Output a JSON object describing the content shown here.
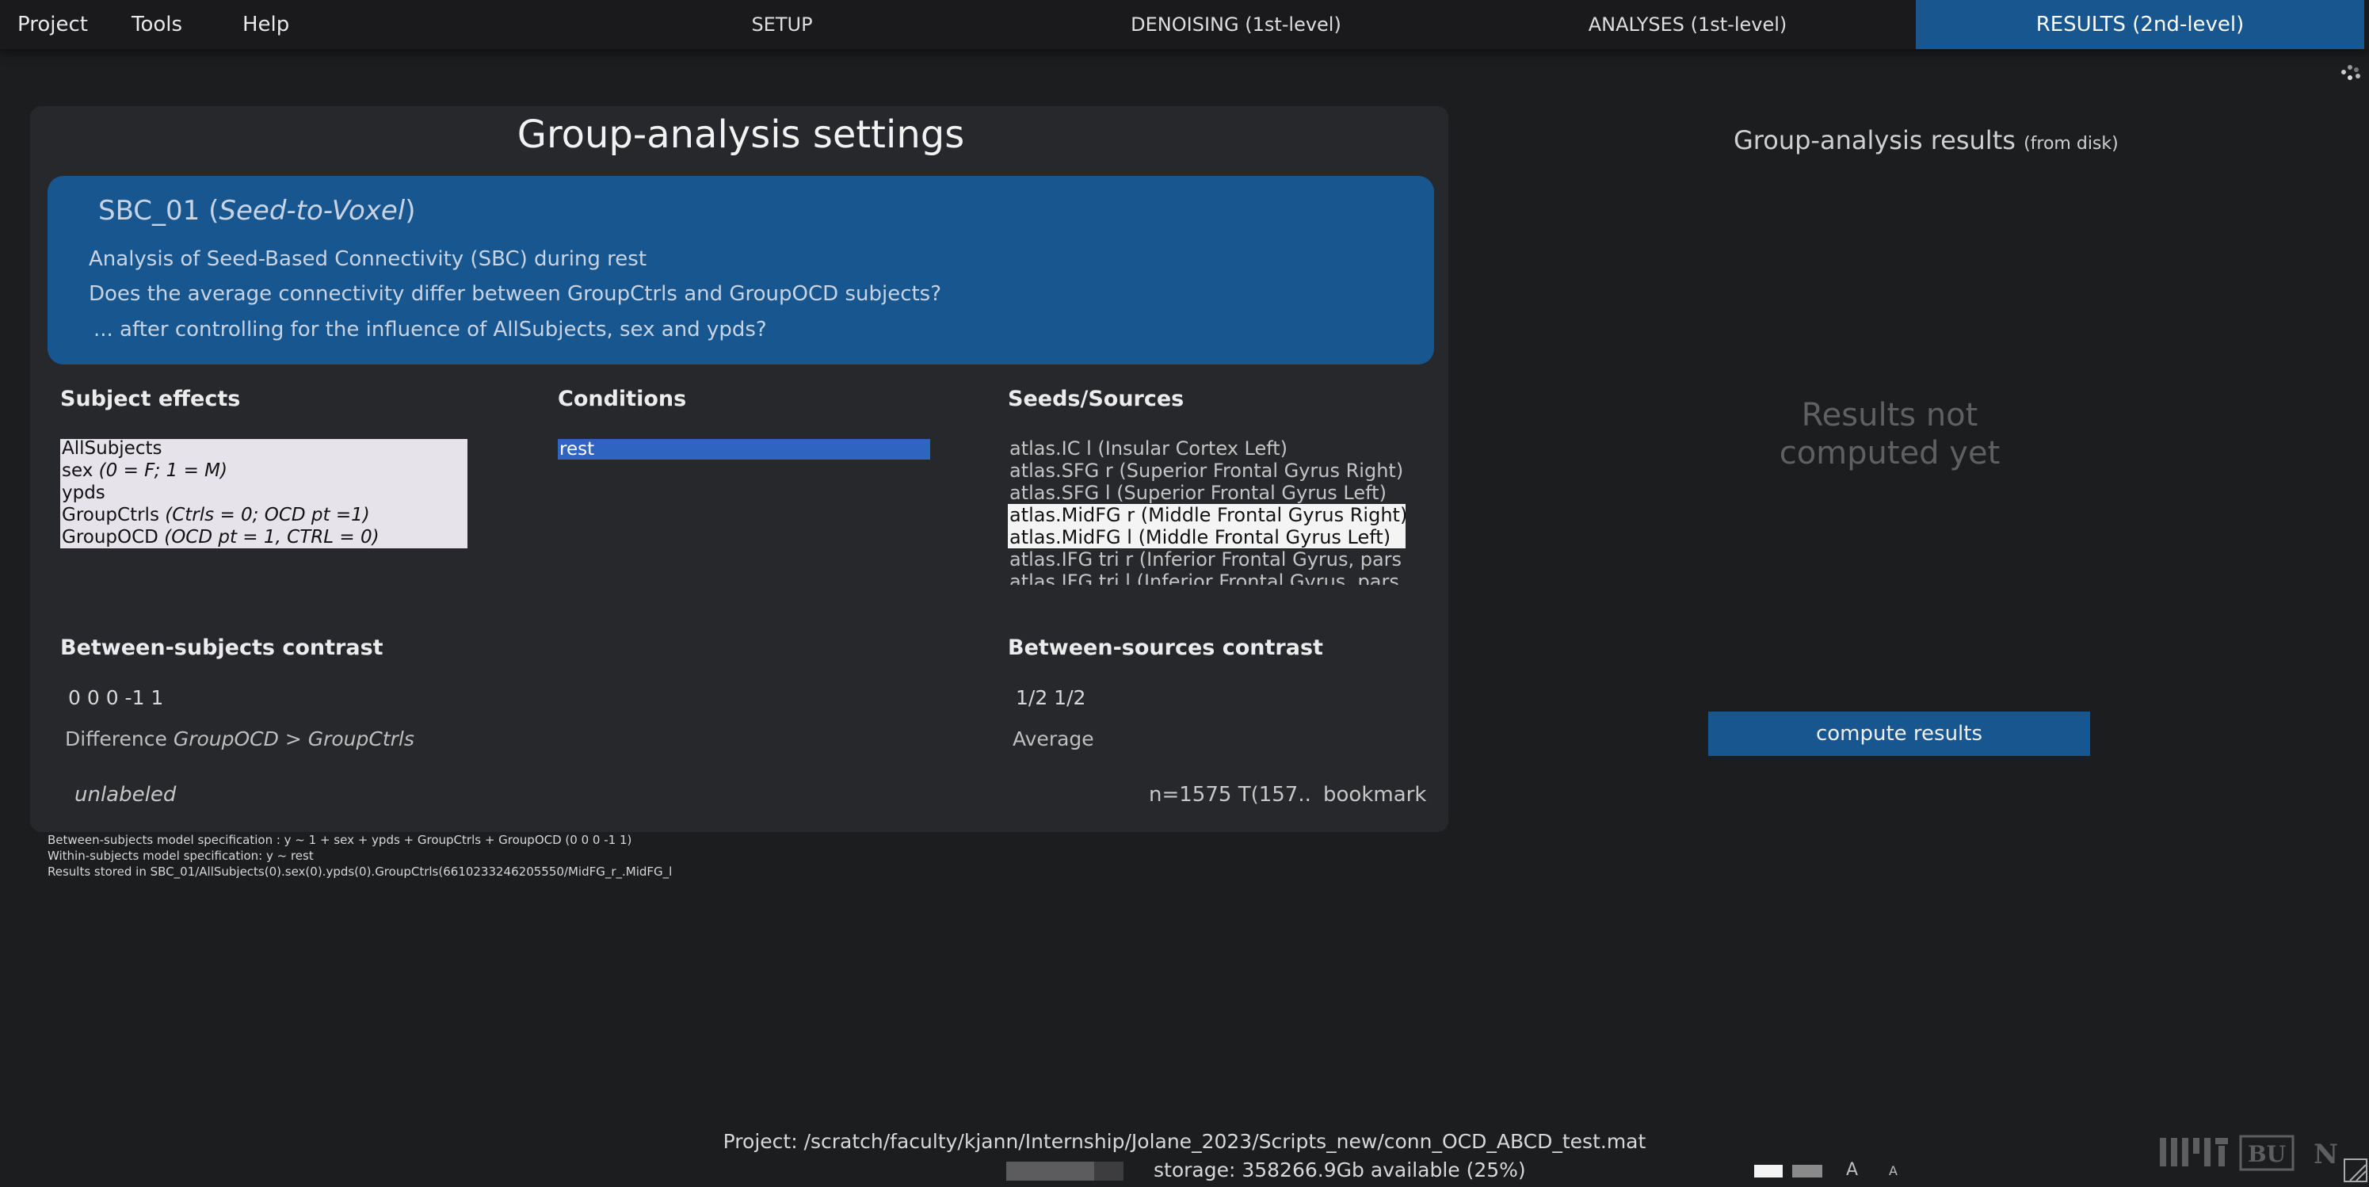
{
  "menu": {
    "project": "Project",
    "tools": "Tools",
    "help": "Help"
  },
  "steps": {
    "setup": "SETUP",
    "denoising": "DENOISING (1st-level)",
    "analyses": "ANALYSES (1st-level)",
    "results": "RESULTS (2nd-level)"
  },
  "settings": {
    "title": "Group-analysis settings",
    "analysis_name": "SBC_01",
    "analysis_type": "Seed-to-Voxel",
    "desc1": "Analysis of Seed-Based Connectivity (SBC) during rest",
    "desc2": "Does the average connectivity differ between GroupCtrls and GroupOCD subjects?",
    "desc3": "... after controlling for the influence of AllSubjects, sex and ypds?",
    "subject_effects_label": "Subject effects",
    "subject_effects": [
      {
        "name": "AllSubjects",
        "note": ""
      },
      {
        "name": "sex ",
        "note": "(0 = F; 1 = M)"
      },
      {
        "name": "ypds",
        "note": ""
      },
      {
        "name": "GroupCtrls ",
        "note": "(Ctrls = 0; OCD pt =1)"
      },
      {
        "name": "GroupOCD ",
        "note": "(OCD pt = 1, CTRL = 0)"
      }
    ],
    "conditions_label": "Conditions",
    "conditions": [
      "rest"
    ],
    "seeds_label": "Seeds/Sources",
    "seeds": [
      {
        "label": "atlas.IC l (Insular Cortex Left)",
        "selected": false
      },
      {
        "label": "atlas.SFG r (Superior Frontal Gyrus Right)",
        "selected": false
      },
      {
        "label": "atlas.SFG l (Superior Frontal Gyrus Left)",
        "selected": false
      },
      {
        "label": "atlas.MidFG r (Middle Frontal Gyrus Right)",
        "selected": true
      },
      {
        "label": "atlas.MidFG l (Middle Frontal Gyrus Left)",
        "selected": true
      },
      {
        "label": "atlas.IFG tri r (Inferior Frontal Gyrus, pars triangularis Right)",
        "selected": false
      },
      {
        "label": "atlas.IFG tri l (Inferior Frontal Gyrus, pars triangularis Left)",
        "selected": false
      }
    ],
    "between_subjects_label": "Between-subjects contrast",
    "between_subjects_value": "0 0 0 -1 1",
    "between_subjects_desc_prefix": "Difference ",
    "between_subjects_desc_italic": "GroupOCD > GroupCtrls",
    "between_sources_label": "Between-sources contrast",
    "between_sources_value": "1/2 1/2",
    "between_sources_desc": "Average",
    "unlabeled": "unlabeled",
    "n_label": "n=1575 T(157..",
    "bookmark": "bookmark"
  },
  "model": {
    "line1": "Between-subjects model specification : y ~ 1 + sex + ypds + GroupCtrls + GroupOCD  (0 0 0 -1 1)",
    "line2": "Within-subjects model specification: y ~ rest",
    "line3": "Results stored in SBC_01/AllSubjects(0).sex(0).ypds(0).GroupCtrls(6610233246205550/MidFG_r_.MidFG_l"
  },
  "results": {
    "title": "Group-analysis results",
    "title_suffix": "(from disk)",
    "not_computed_1": "Results not",
    "not_computed_2": "computed yet",
    "compute_button": "compute results"
  },
  "footer": {
    "project_path": "Project: /scratch/faculty/kjann/Internship/Jolane_2023/Scripts_new/conn_OCD_ABCD_test.mat",
    "storage": "storage: 358266.9Gb available (25%)",
    "storage_fraction": 0.75,
    "font_big": "A",
    "font_small": "A",
    "logos": [
      "mit-logo",
      "bu-logo",
      "nitrc-logo"
    ]
  },
  "colors": {
    "accent": "#17568f",
    "background": "#1c1d1f",
    "panel": "#27282b",
    "selection": "#2f65c1"
  }
}
